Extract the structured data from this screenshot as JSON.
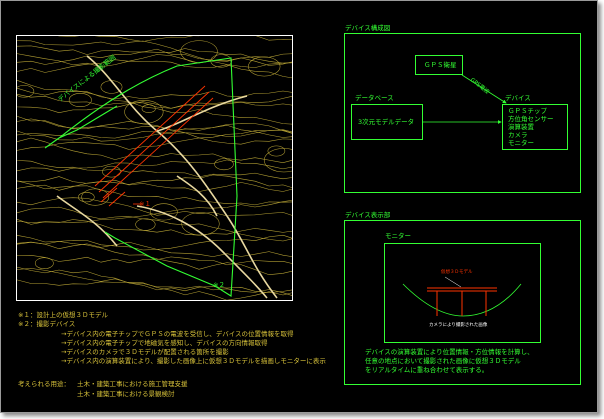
{
  "config_panel": {
    "title": "デバイス構成図",
    "gps_sat": "ＧＰＳ衛星",
    "gps_signal": "GPS電波",
    "database": "データベース",
    "model_data": "3次元モデルデータ",
    "device_title": "デバイス",
    "device_items": [
      "ＧＰＳチップ",
      "方位角センサー",
      "演算装置",
      "カメラ",
      "モニター"
    ]
  },
  "display_panel": {
    "title": "デバイス表示部",
    "monitor": "モニター",
    "label_model": "仮想３Ｄモデル",
    "label_caption": "カメラにより撮影された画像",
    "desc": [
      "デバイスの演算装置により位置情報・方位情報を計算し、",
      "任意の地点において撮影された画像に仮想３Ｄモデル",
      "をリアルタイムに重ね合わせて表示する。"
    ]
  },
  "map": {
    "label_camera": "撮影デバイス",
    "label_range": "デバイスによる撮影範囲",
    "label_3d": "※１",
    "label_2": "※２"
  },
  "notes": {
    "n1": "※１：設計上の仮想３Ｄモデル",
    "n2": "※２：撮影デバイス",
    "n2_items": [
      "→デバイス内の電子チップでＧＰＳの電波を受信し、デバイスの位置情報を取得",
      "→デバイス内の電子チップで地磁気を感知し、デバイスの方向情報取得",
      "→デバイスのカメラで３Ｄモデルが配置される箇所を撮影",
      "→デバイス内の演算装置により、撮影した画像上に仮想３Ｄモデルを描画しモニターに表示"
    ],
    "uses_label": "考えられる用途：",
    "uses": [
      "土木・建築工事における施工管理支援",
      "土木・建築工事における景観検討"
    ]
  },
  "colors": {
    "line": "#33ff33",
    "contour": "#d8c23a",
    "model": "#ff3300",
    "bg": "#000000"
  }
}
